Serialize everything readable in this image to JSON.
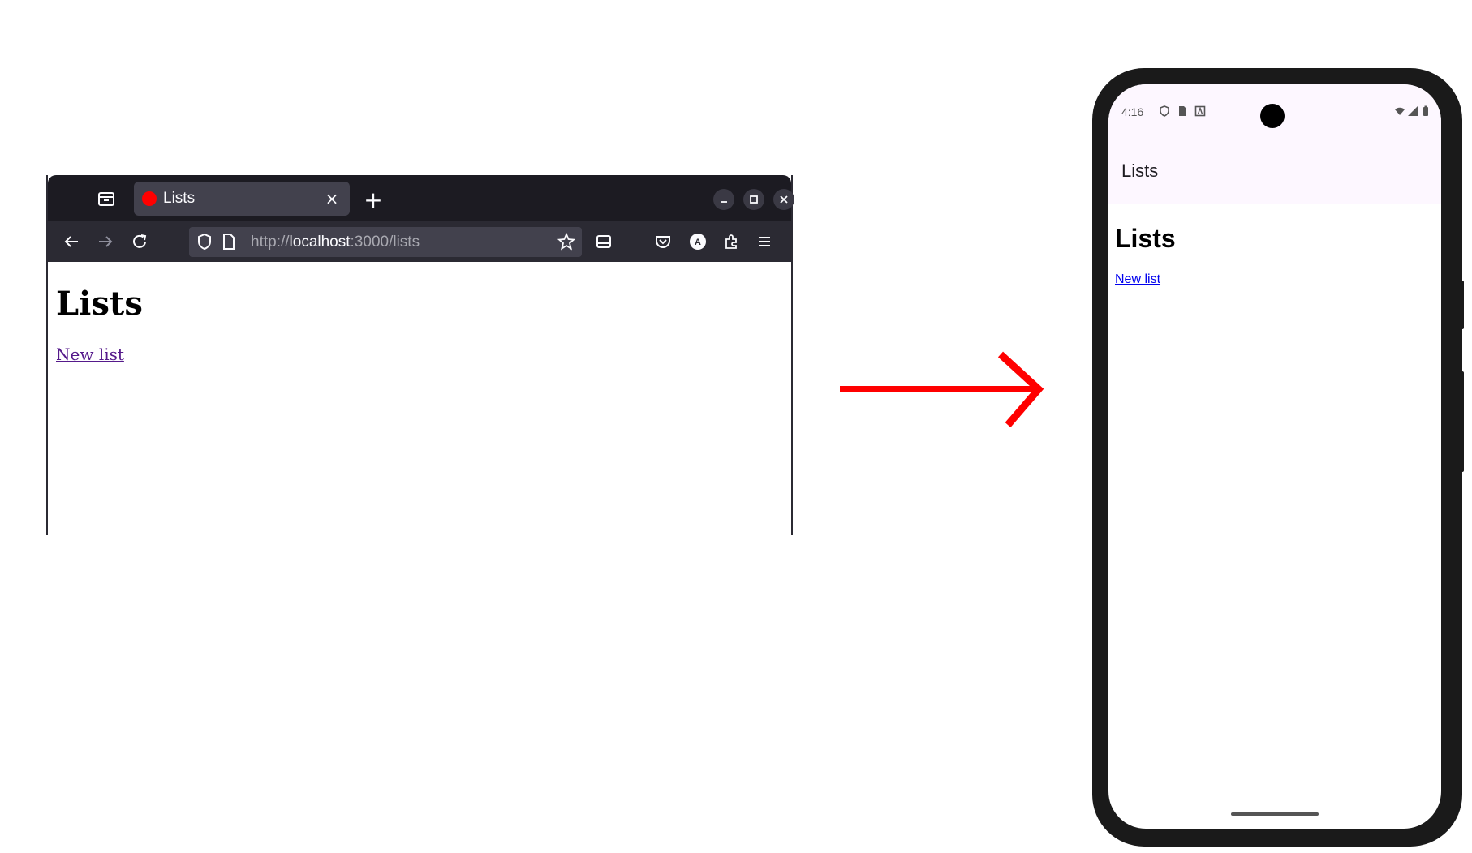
{
  "browser": {
    "tab_title": "Lists",
    "tab_close": "×",
    "new_tab": "+",
    "url": {
      "scheme": "http://",
      "host": "localhost",
      "rest": ":3000/lists"
    },
    "page": {
      "heading": "Lists",
      "link": "New list"
    },
    "account_initial": "A"
  },
  "phone": {
    "status_time": "4:16",
    "app_bar_title": "Lists",
    "page": {
      "heading": "Lists",
      "link": "New list"
    }
  },
  "colors": {
    "arrow": "#ff0000",
    "favicon": "#ff0000",
    "visited_link": "#551a8b",
    "link": "#0000ee",
    "browser_chrome": "#1c1b22",
    "app_bar": "#fdf7ff"
  }
}
